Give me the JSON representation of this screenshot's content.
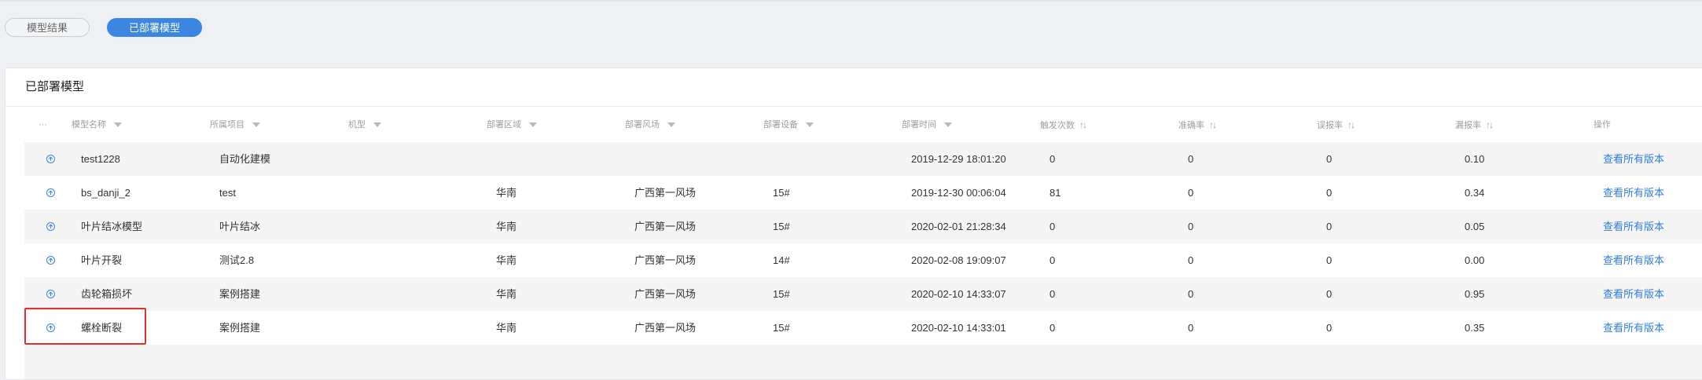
{
  "tabs": [
    {
      "label": "模型结果",
      "active": false
    },
    {
      "label": "已部署模型",
      "active": true
    }
  ],
  "panel": {
    "title": "已部署模型"
  },
  "table": {
    "headers": {
      "expand": "···",
      "name": "模型名称",
      "project": "所属项目",
      "model_type": "机型",
      "region": "部署区域",
      "farm": "部署风场",
      "device": "部署设备",
      "time": "部署时间",
      "trigger": "触发次数",
      "accuracy": "准确率",
      "false_rate": "误报率",
      "miss_rate": "漏报率",
      "action": "操作"
    },
    "rows": [
      {
        "name": "test1228",
        "project": "自动化建模",
        "model_type": "",
        "region": "",
        "farm": "",
        "device": "",
        "time": "2019-12-29 18:01:20",
        "trigger": "0",
        "accuracy": "0",
        "false_rate": "0",
        "miss_rate": "0.10",
        "action": "查看所有版本"
      },
      {
        "name": "bs_danji_2",
        "project": "test",
        "model_type": "",
        "region": "华南",
        "farm": "广西第一风场",
        "device": "15#",
        "time": "2019-12-30 00:06:04",
        "trigger": "81",
        "accuracy": "0",
        "false_rate": "0",
        "miss_rate": "0.34",
        "action": "查看所有版本"
      },
      {
        "name": "叶片结冰模型",
        "project": "叶片结冰",
        "model_type": "",
        "region": "华南",
        "farm": "广西第一风场",
        "device": "15#",
        "time": "2020-02-01 21:28:34",
        "trigger": "0",
        "accuracy": "0",
        "false_rate": "0",
        "miss_rate": "0.05",
        "action": "查看所有版本"
      },
      {
        "name": "叶片开裂",
        "project": "测试2.8",
        "model_type": "",
        "region": "华南",
        "farm": "广西第一风场",
        "device": "14#",
        "time": "2020-02-08 19:09:07",
        "trigger": "0",
        "accuracy": "0",
        "false_rate": "0",
        "miss_rate": "0.00",
        "action": "查看所有版本"
      },
      {
        "name": "齿轮箱损坏",
        "project": "案例搭建",
        "model_type": "",
        "region": "华南",
        "farm": "广西第一风场",
        "device": "15#",
        "time": "2020-02-10 14:33:07",
        "trigger": "0",
        "accuracy": "0",
        "false_rate": "0",
        "miss_rate": "0.95",
        "action": "查看所有版本"
      },
      {
        "name": "螺栓断裂",
        "project": "案例搭建",
        "model_type": "",
        "region": "华南",
        "farm": "广西第一风场",
        "device": "15#",
        "time": "2020-02-10 14:33:01",
        "trigger": "0",
        "accuracy": "0",
        "false_rate": "0",
        "miss_rate": "0.35",
        "action": "查看所有版本"
      }
    ]
  },
  "colors": {
    "accent": "#3a86e0",
    "link": "#2f7de1",
    "highlight": "#e0302c"
  }
}
